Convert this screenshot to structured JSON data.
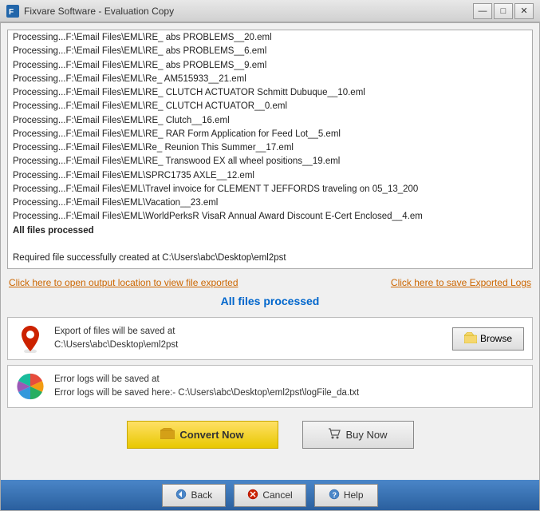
{
  "titleBar": {
    "title": "Fixvare Software - Evaluation Copy",
    "minimizeLabel": "—",
    "maximizeLabel": "□",
    "closeLabel": "✕"
  },
  "logLines": [
    "Processing...F:\\Email Files\\EML\\RE_ abs PROBLEMS__20.eml",
    "Processing...F:\\Email Files\\EML\\RE_ abs PROBLEMS__6.eml",
    "Processing...F:\\Email Files\\EML\\RE_ abs PROBLEMS__9.eml",
    "Processing...F:\\Email Files\\EML\\Re_ AM515933__21.eml",
    "Processing...F:\\Email Files\\EML\\RE_ CLUTCH ACTUATOR Schmitt Dubuque__10.eml",
    "Processing...F:\\Email Files\\EML\\RE_ CLUTCH ACTUATOR__0.eml",
    "Processing...F:\\Email Files\\EML\\RE_ Clutch__16.eml",
    "Processing...F:\\Email Files\\EML\\RE_ RAR Form Application for Feed Lot__5.eml",
    "Processing...F:\\Email Files\\EML\\Re_ Reunion This Summer__17.eml",
    "Processing...F:\\Email Files\\EML\\RE_ Transwood EX all wheel positions__19.eml",
    "Processing...F:\\Email Files\\EML\\SPRC1735 AXLE__12.eml",
    "Processing...F:\\Email Files\\EML\\Travel invoice for CLEMENT T JEFFORDS traveling on 05_13_200",
    "Processing...F:\\Email Files\\EML\\Vacation__23.eml",
    "Processing...F:\\Email Files\\EML\\WorldPerksR VisaR Annual Award Discount E-Cert Enclosed__4.em",
    "All files processed",
    "",
    "Required file successfully created at C:\\Users\\abc\\Desktop\\eml2pst"
  ],
  "links": {
    "openOutput": "Click here to open output location to view file exported",
    "saveLogs": "Click here to save Exported Logs"
  },
  "statusBanner": "All files processed",
  "exportInfo": {
    "iconSymbol": "📍",
    "label1": "Export of files will be saved at",
    "path1": "C:\\Users\\abc\\Desktop\\eml2pst",
    "browseLabel": "Browse",
    "label2": "Error logs will be saved at",
    "errorLogLabel": "Error logs will be saved here:- C:\\Users\\abc\\Desktop\\eml2pst\\logFile_da.txt"
  },
  "buttons": {
    "convertNow": "Convert Now",
    "buyNow": "Buy Now",
    "back": "Back",
    "cancel": "Cancel",
    "help": "Help"
  }
}
